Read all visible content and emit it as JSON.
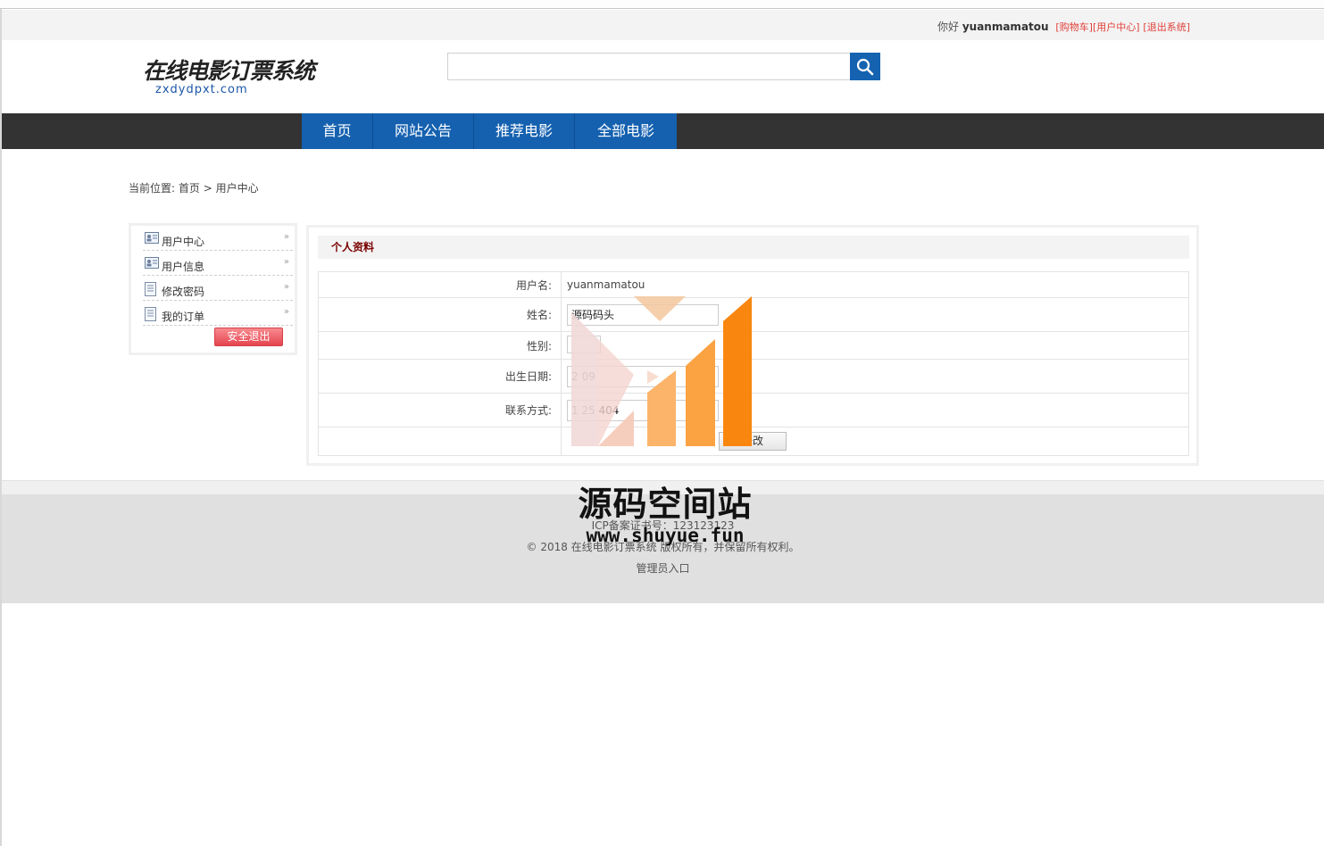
{
  "topbar": {
    "greeting": "你好",
    "username": "yuanmamatou",
    "cart_link": "[购物车]",
    "user_center_link": "[用户中心]",
    "logout_link": "[退出系统]"
  },
  "header": {
    "logo_title": "在线电影订票系统",
    "logo_url": "zxdydpxt.com",
    "search": {
      "value": "",
      "placeholder": ""
    }
  },
  "nav": {
    "items": [
      {
        "label": "首页"
      },
      {
        "label": "网站公告"
      },
      {
        "label": "推荐电影"
      },
      {
        "label": "全部电影"
      }
    ]
  },
  "breadcrumb": {
    "prefix": "当前位置:",
    "home": "首页",
    "separator": ">",
    "current": "用户中心"
  },
  "sidebar": {
    "items": [
      {
        "label": "用户中心",
        "icon": "user-card-icon"
      },
      {
        "label": "用户信息",
        "icon": "user-card-icon"
      },
      {
        "label": "修改密码",
        "icon": "document-icon"
      },
      {
        "label": "我的订单",
        "icon": "document-icon"
      }
    ],
    "logout_button": "安全退出"
  },
  "profile": {
    "title": "个人资料",
    "rows": {
      "username_label": "用户名:",
      "username_value": "yuanmamatou",
      "name_label": "姓名:",
      "name_value": "源码码头",
      "gender_label": "性别:",
      "gender_value": "",
      "birthday_label": "出生日期:",
      "birthday_value": "2 09",
      "contact_label": "联系方式:",
      "contact_value": "1 25 404"
    },
    "submit_button": "修改"
  },
  "footer": {
    "icp": "ICP备案证书号：123123123",
    "copyright": "© 2018 在线电影订票系统 版权所有，并保留所有权利。",
    "admin_link": "管理员入口"
  },
  "watermark": {
    "text": "源码空间站",
    "url": "www.shuyue.fun"
  },
  "colors": {
    "nav_bg": "#333333",
    "nav_active": "#1561b0",
    "link_red": "#e0413a",
    "section_title": "#7a0000",
    "footer_bg": "#e0e0e0"
  }
}
